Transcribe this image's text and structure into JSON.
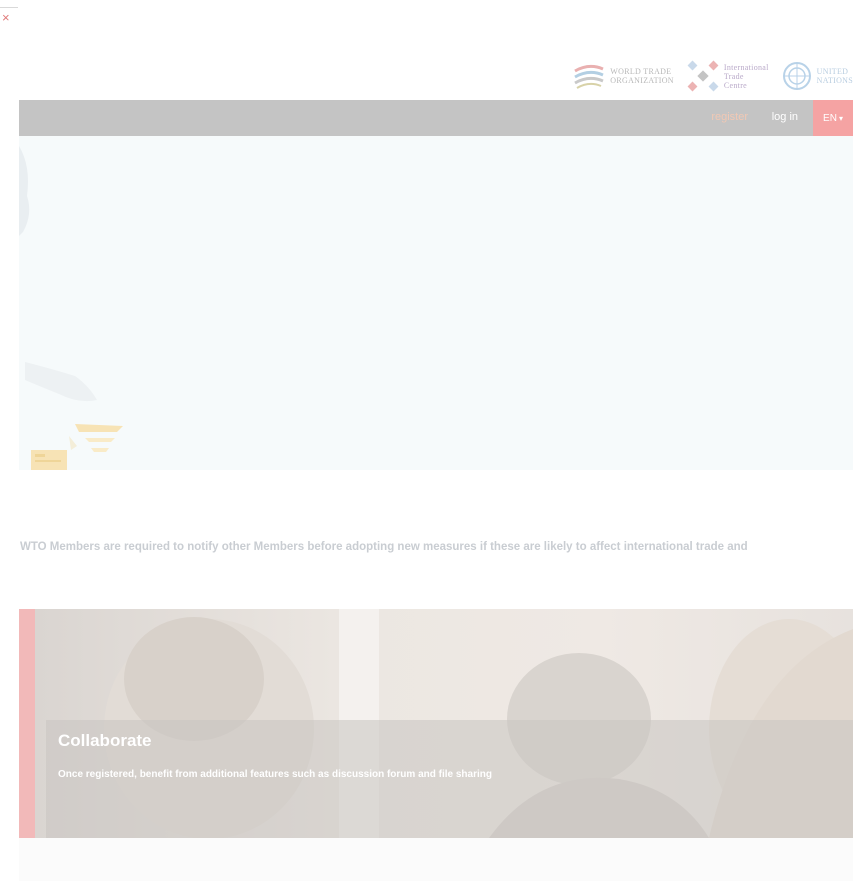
{
  "close": {
    "glyph": "×"
  },
  "logos": {
    "wto": {
      "line1": "World Trade",
      "line2": "Organization"
    },
    "itc": {
      "line1": "International",
      "line2": "Trade",
      "line3": "Centre"
    },
    "un": {
      "line1": "United",
      "line2": "Nations"
    }
  },
  "nav": {
    "register": "register",
    "login": "log in",
    "language": "EN"
  },
  "intro": {
    "text": "WTO Members are required to notify other Members before adopting new measures if these are likely to affect international trade and"
  },
  "collaborate": {
    "title": "Collaborate",
    "description": "Once registered, benefit from additional features such as discussion forum and file sharing"
  },
  "colors": {
    "topbar": "#c4c4c4",
    "accent": "#f5a3a3",
    "register_link": "#f1c8b4",
    "hero_bg": "#f6fafb"
  }
}
